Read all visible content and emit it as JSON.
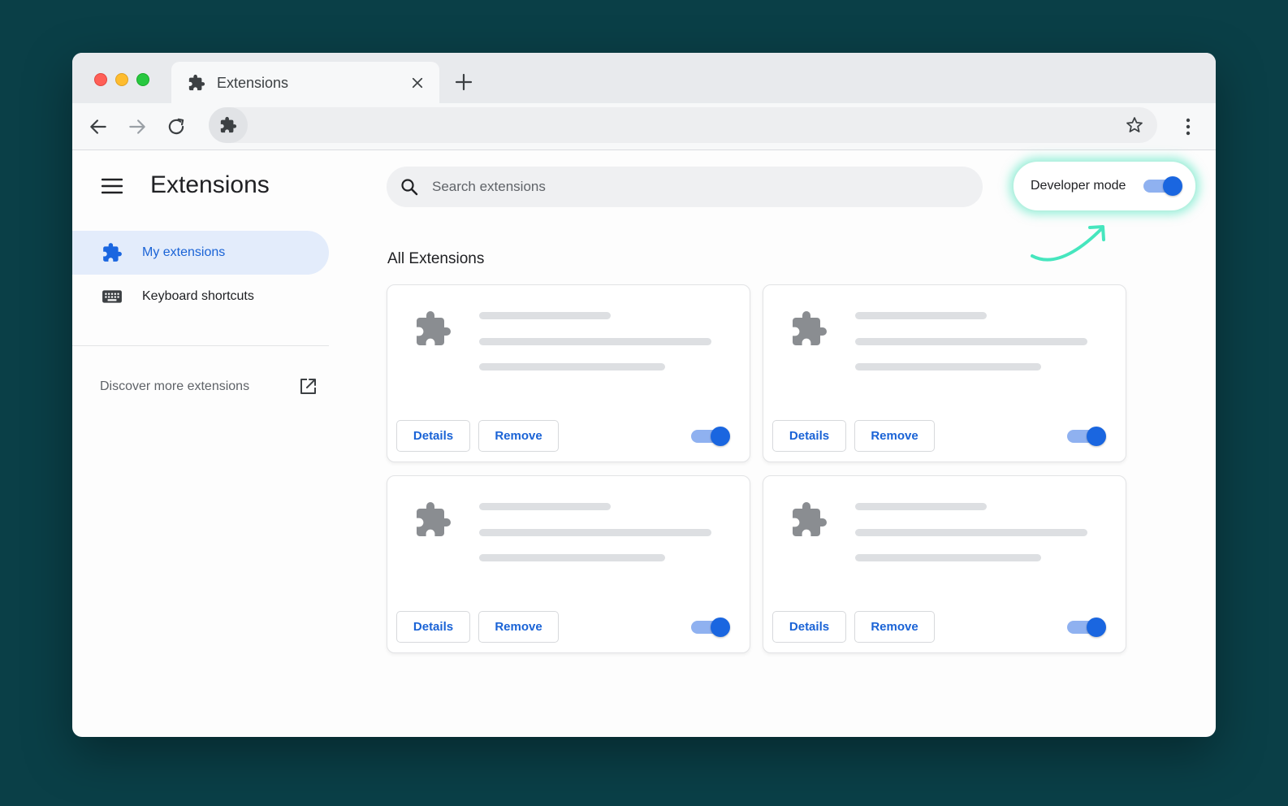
{
  "tab": {
    "title": "Extensions"
  },
  "sidebar": {
    "title": "Extensions",
    "items": [
      {
        "label": "My extensions",
        "icon": "puzzle-icon",
        "active": true
      },
      {
        "label": "Keyboard shortcuts",
        "icon": "keyboard-icon",
        "active": false
      }
    ],
    "discover": {
      "label": "Discover more extensions",
      "icon": "external-link-icon"
    }
  },
  "search": {
    "placeholder": "Search extensions",
    "value": ""
  },
  "developer_mode": {
    "label": "Developer mode",
    "enabled": true
  },
  "main": {
    "section_title": "All Extensions",
    "cards": [
      {
        "details_label": "Details",
        "remove_label": "Remove",
        "enabled": true
      },
      {
        "details_label": "Details",
        "remove_label": "Remove",
        "enabled": true
      },
      {
        "details_label": "Details",
        "remove_label": "Remove",
        "enabled": true
      },
      {
        "details_label": "Details",
        "remove_label": "Remove",
        "enabled": true
      }
    ]
  },
  "colors": {
    "accent": "#1a66e0",
    "active_nav_bg": "#e3ecfb",
    "highlight_glow": "#46e6be",
    "backdrop": "#0a3f47"
  }
}
